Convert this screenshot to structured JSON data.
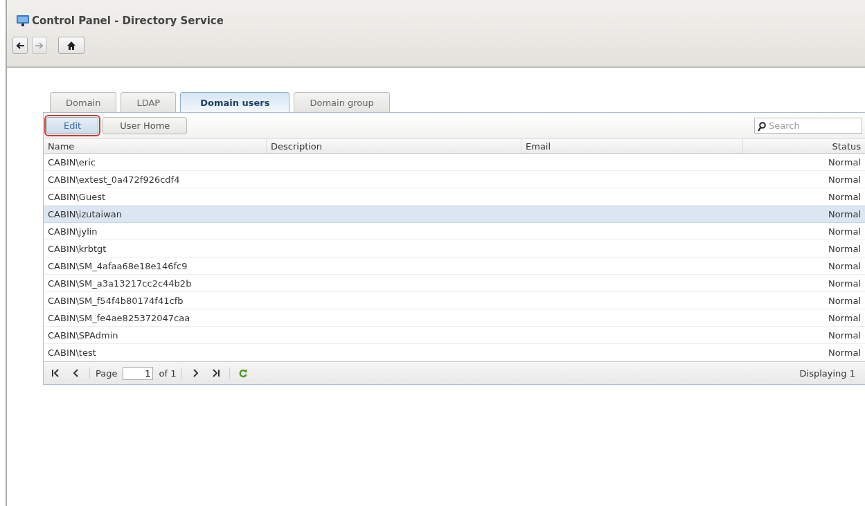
{
  "window": {
    "title": "Control Panel - Directory Service"
  },
  "nav": [
    {
      "kind": "back",
      "disabled": false
    },
    {
      "kind": "forward",
      "disabled": true
    },
    {
      "kind": "home",
      "disabled": false
    }
  ],
  "tabs": [
    {
      "label": "Domain",
      "selected": false
    },
    {
      "label": "LDAP",
      "selected": false
    },
    {
      "label": "Domain users",
      "selected": true
    },
    {
      "label": "Domain group",
      "selected": false
    }
  ],
  "toolbar": {
    "buttons": [
      {
        "label": "Edit",
        "highlighted": true
      },
      {
        "label": "User Home",
        "highlighted": false
      }
    ],
    "search": {
      "placeholder": "Search"
    }
  },
  "table": {
    "columns": [
      "Name",
      "Description",
      "Email",
      "Status"
    ],
    "rows": [
      {
        "name": "CABIN\\eric",
        "status": "Normal",
        "selected": false
      },
      {
        "name": "CABIN\\extest_0a472f926cdf4",
        "status": "Normal",
        "selected": false
      },
      {
        "name": "CABIN\\Guest",
        "status": "Normal",
        "selected": false
      },
      {
        "name": "CABIN\\izutaiwan",
        "status": "Normal",
        "selected": true
      },
      {
        "name": "CABIN\\jylin",
        "status": "Normal",
        "selected": false
      },
      {
        "name": "CABIN\\krbtgt",
        "status": "Normal",
        "selected": false
      },
      {
        "name": "CABIN\\SM_4afaa68e18e146fc9",
        "status": "Normal",
        "selected": false
      },
      {
        "name": "CABIN\\SM_a3a13217cc2c44b2b",
        "status": "Normal",
        "selected": false
      },
      {
        "name": "CABIN\\SM_f54f4b80174f41cfb",
        "status": "Normal",
        "selected": false
      },
      {
        "name": "CABIN\\SM_fe4ae825372047caa",
        "status": "Normal",
        "selected": false
      },
      {
        "name": "CABIN\\SPAdmin",
        "status": "Normal",
        "selected": false
      },
      {
        "name": "CABIN\\test",
        "status": "Normal",
        "selected": false
      }
    ]
  },
  "pager": {
    "page_label": "Page",
    "page": "1",
    "of": "of 1",
    "summary": "Displaying 1"
  }
}
